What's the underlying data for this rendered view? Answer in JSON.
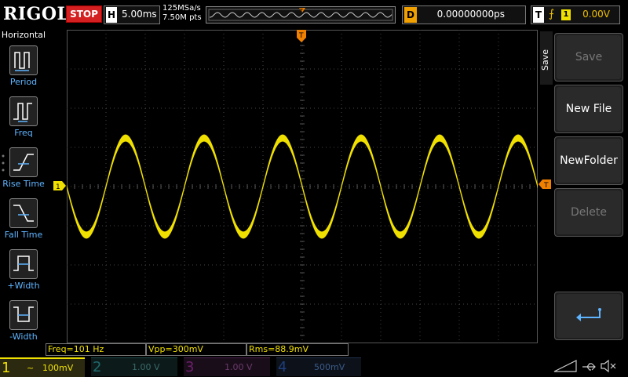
{
  "top": {
    "brand": "RIGOL",
    "run_state": "STOP",
    "horizontal_label": "H",
    "timebase": "5.00ms",
    "sample_rate": "125MSa/s",
    "memory_depth": "7.50M pts",
    "delay_label": "D",
    "delay_value": "0.00000000ps",
    "trigger_label": "T",
    "trigger_channel": "1",
    "trigger_level": "0.00V"
  },
  "left_menu": {
    "title": "Horizontal",
    "items": [
      {
        "label": "Period",
        "icon": "period-icon"
      },
      {
        "label": "Freq",
        "icon": "freq-icon"
      },
      {
        "label": "Rise Time",
        "icon": "rise-time-icon"
      },
      {
        "label": "Fall Time",
        "icon": "fall-time-icon"
      },
      {
        "label": "+Width",
        "icon": "pos-width-icon"
      },
      {
        "label": "-Width",
        "icon": "neg-width-icon"
      }
    ]
  },
  "right_menu": {
    "side_label": "Save",
    "buttons": [
      {
        "label": "Save",
        "enabled": false
      },
      {
        "label": "New File",
        "enabled": true
      },
      {
        "label": "NewFolder",
        "enabled": true
      },
      {
        "label": "Delete",
        "enabled": false
      }
    ],
    "return_icon": "return-icon"
  },
  "markers": {
    "channel_marker": "1",
    "trigger_marker": "T"
  },
  "measurements": [
    {
      "label": "Freq=101 Hz"
    },
    {
      "label": "Vpp=300mV"
    },
    {
      "label": "Rms=88.9mV"
    }
  ],
  "channels": [
    {
      "num": "1",
      "coupling": "~",
      "scale": "100mV",
      "active": true,
      "color": "#f0e000"
    },
    {
      "num": "2",
      "coupling": "",
      "scale": "1.00 V",
      "active": false,
      "color": "#2fa4a8"
    },
    {
      "num": "3",
      "coupling": "",
      "scale": "1.00 V",
      "active": false,
      "color": "#c040c0"
    },
    {
      "num": "4",
      "coupling": "",
      "scale": "500mV",
      "active": false,
      "color": "#2f6fd0"
    }
  ],
  "colors": {
    "ch1": "#f0e000",
    "trigger": "#f08000",
    "accent": "#5fb4ff"
  }
}
